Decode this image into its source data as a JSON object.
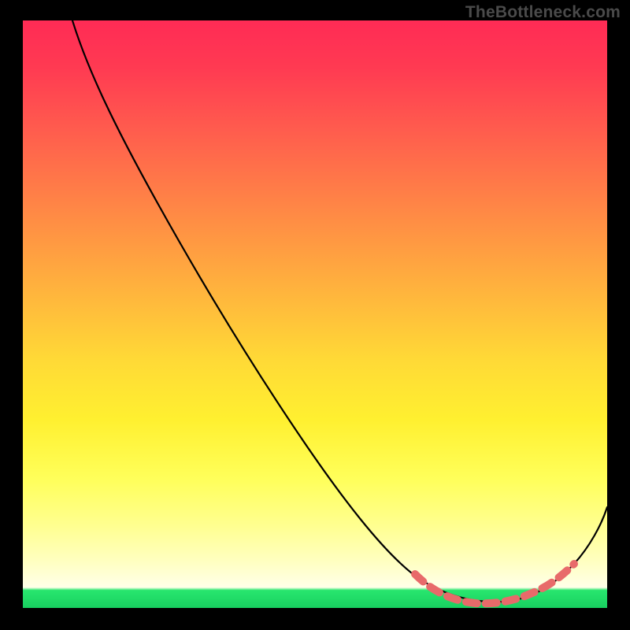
{
  "watermark": "TheBottleneck.com",
  "colors": {
    "frame": "#000000",
    "gradient_top": "#ff2b55",
    "gradient_bottom": "#18d060",
    "curve": "#000000",
    "dash": "#e86a6a"
  },
  "chart_data": {
    "type": "line",
    "title": "",
    "xlabel": "",
    "ylabel": "",
    "xlim": [
      0,
      100
    ],
    "ylim": [
      0,
      100
    ],
    "x": [
      8,
      12,
      16,
      20,
      24,
      28,
      32,
      36,
      40,
      44,
      48,
      52,
      56,
      60,
      64,
      68,
      72,
      76,
      80,
      84,
      88,
      92,
      96,
      100
    ],
    "values": [
      102,
      98,
      93,
      87,
      80,
      74,
      68,
      62,
      56,
      50,
      44,
      38,
      32,
      26,
      20,
      14,
      8,
      4,
      2,
      2,
      3,
      6,
      13,
      24
    ],
    "highlight_range_x": [
      70,
      92
    ],
    "annotation": "TheBottleneck.com"
  }
}
